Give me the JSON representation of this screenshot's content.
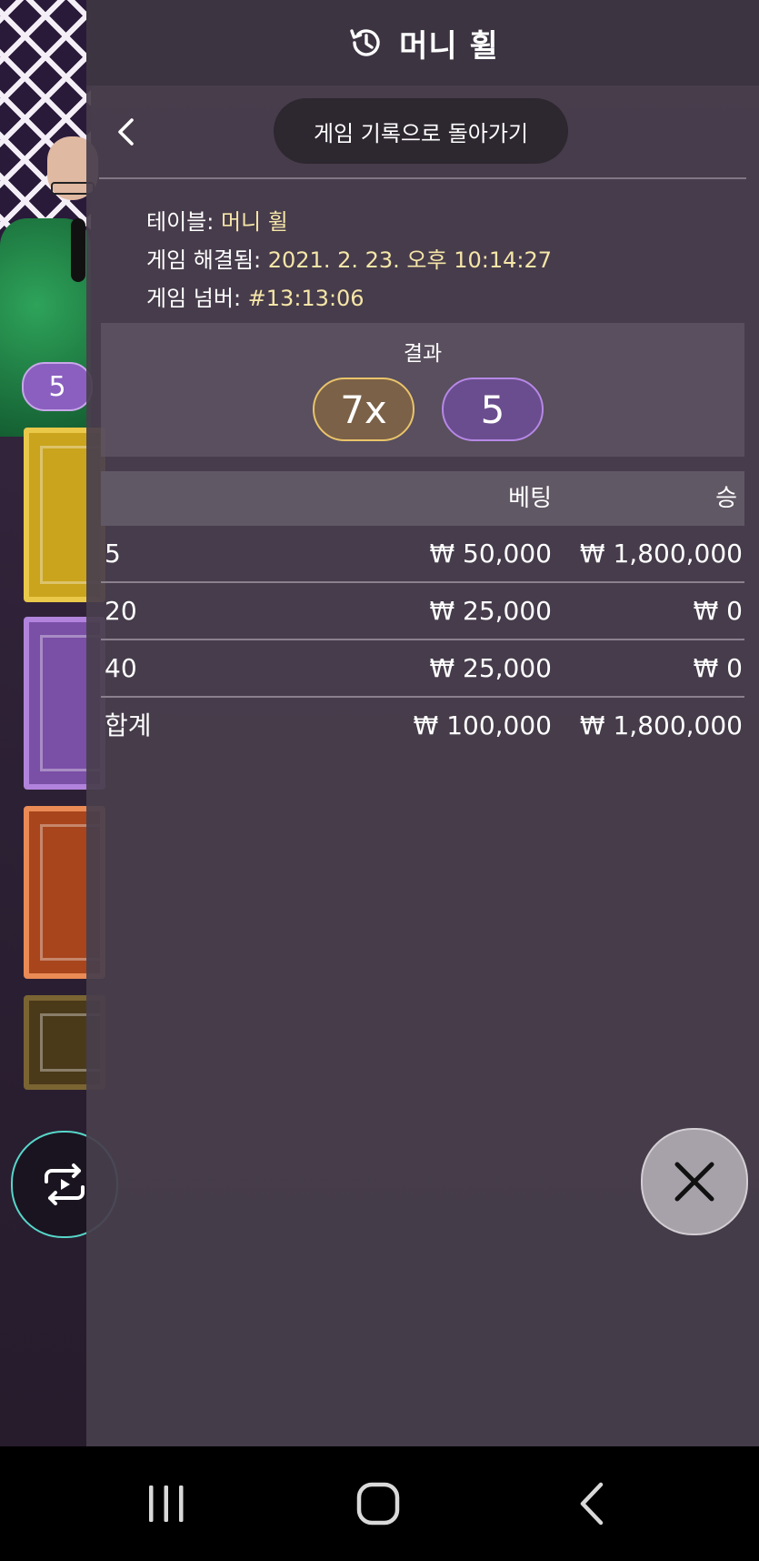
{
  "panel": {
    "title": "머니 휠",
    "back_label": "게임 기록으로 돌아가기",
    "table_label": "테이블: ",
    "table_value": "머니 휠",
    "resolved_label": "게임 해결됨: ",
    "resolved_value": "2021. 2. 23. 오후 10:14:27",
    "game_number_label": "게임 넘버: ",
    "game_number_value": "#13:13:06",
    "result_label": "결과",
    "result_multiplier": "7x",
    "result_number": "5"
  },
  "bets_table": {
    "headers": {
      "bet": "베팅",
      "win": "승"
    },
    "rows": [
      {
        "number": "5",
        "bet": "₩ 50,000",
        "win": "₩ 1,800,000"
      },
      {
        "number": "20",
        "bet": "₩ 25,000",
        "win": "₩ 0"
      },
      {
        "number": "40",
        "bet": "₩ 25,000",
        "win": "₩ 0"
      }
    ],
    "total": {
      "label": "합계",
      "bet": "₩ 100,000",
      "win": "₩ 1,800,000"
    }
  },
  "background": {
    "badge_number": "5"
  },
  "icons": {
    "header": "history-icon",
    "back": "chevron-left-icon",
    "close": "close-icon",
    "repeat": "repeat-icon",
    "nav_recents": "recents-icon",
    "nav_home": "home-icon",
    "nav_back": "nav-back-icon"
  },
  "colors": {
    "panel_bg": "#483e4c",
    "multiplier_border": "#e9c46a",
    "number_border": "#b688e6",
    "meta_value": "#f6e6a8",
    "repeat_border": "#57d6c9"
  }
}
